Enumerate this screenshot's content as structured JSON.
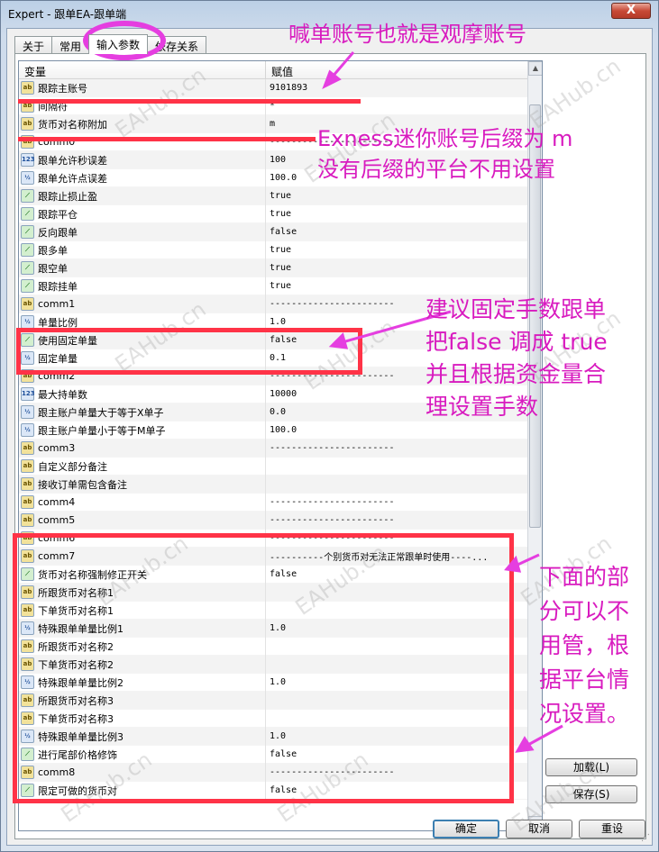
{
  "window": {
    "title": "Expert - 跟单EA-跟单端",
    "close_label": "X"
  },
  "tabs": [
    {
      "label": "关于",
      "active": false
    },
    {
      "label": "常用",
      "active": false
    },
    {
      "label": "输入参数",
      "active": true
    },
    {
      "label": "依存关系",
      "active": false
    }
  ],
  "grid": {
    "header_variable": "变量",
    "header_value": "赋值",
    "rows": [
      {
        "type": "ab",
        "name": "跟踪主账号",
        "value": "9101893"
      },
      {
        "type": "ab",
        "name": "间隔符",
        "value": "*"
      },
      {
        "type": "ab",
        "name": "货币对名称附加",
        "value": "m"
      },
      {
        "type": "ab",
        "name": "comm0",
        "value": "-----------------------"
      },
      {
        "type": "123",
        "name": "跟单允许秒误差",
        "value": "100"
      },
      {
        "type": "v2",
        "name": "跟单允许点误差",
        "value": "100.0"
      },
      {
        "type": "bool",
        "name": "跟踪止损止盈",
        "value": "true"
      },
      {
        "type": "bool",
        "name": "跟踪平仓",
        "value": "true"
      },
      {
        "type": "bool",
        "name": "反向跟单",
        "value": "false"
      },
      {
        "type": "bool",
        "name": "跟多单",
        "value": "true"
      },
      {
        "type": "bool",
        "name": "跟空单",
        "value": "true"
      },
      {
        "type": "bool",
        "name": "跟踪挂单",
        "value": "true"
      },
      {
        "type": "ab",
        "name": "comm1",
        "value": "-----------------------"
      },
      {
        "type": "v2",
        "name": "单量比例",
        "value": "1.0"
      },
      {
        "type": "bool",
        "name": "使用固定单量",
        "value": "false"
      },
      {
        "type": "v2",
        "name": "固定单量",
        "value": "0.1"
      },
      {
        "type": "ab",
        "name": "comm2",
        "value": "-----------------------"
      },
      {
        "type": "123",
        "name": "最大持单数",
        "value": "10000"
      },
      {
        "type": "v2",
        "name": "跟主账户单量大于等于X单子",
        "value": "0.0"
      },
      {
        "type": "v2",
        "name": "跟主账户单量小于等于M单子",
        "value": "100.0"
      },
      {
        "type": "ab",
        "name": "comm3",
        "value": "-----------------------"
      },
      {
        "type": "ab",
        "name": "自定义部分备注",
        "value": ""
      },
      {
        "type": "ab",
        "name": "接收订单需包含备注",
        "value": ""
      },
      {
        "type": "ab",
        "name": "comm4",
        "value": "-----------------------"
      },
      {
        "type": "ab",
        "name": "comm5",
        "value": "-----------------------"
      },
      {
        "type": "ab",
        "name": "comm6",
        "value": "-----------------------"
      },
      {
        "type": "ab",
        "name": "comm7",
        "value": "----------个别货币对无法正常跟单时使用----..."
      },
      {
        "type": "bool",
        "name": "货币对名称强制修正开关",
        "value": "false"
      },
      {
        "type": "ab",
        "name": "所跟货币对名称1",
        "value": ""
      },
      {
        "type": "ab",
        "name": "下单货币对名称1",
        "value": ""
      },
      {
        "type": "v2",
        "name": "特殊跟单单量比例1",
        "value": "1.0"
      },
      {
        "type": "ab",
        "name": "所跟货币对名称2",
        "value": ""
      },
      {
        "type": "ab",
        "name": "下单货币对名称2",
        "value": ""
      },
      {
        "type": "v2",
        "name": "特殊跟单单量比例2",
        "value": "1.0"
      },
      {
        "type": "ab",
        "name": "所跟货币对名称3",
        "value": ""
      },
      {
        "type": "ab",
        "name": "下单货币对名称3",
        "value": ""
      },
      {
        "type": "v2",
        "name": "特殊跟单单量比例3",
        "value": "1.0"
      },
      {
        "type": "bool",
        "name": "进行尾部价格修饰",
        "value": "false"
      },
      {
        "type": "ab",
        "name": "comm8",
        "value": "-----------------------"
      },
      {
        "type": "bool",
        "name": "限定可做的货币对",
        "value": "false"
      }
    ]
  },
  "buttons": {
    "load": "加载(L)",
    "save": "保存(S)",
    "ok": "确定",
    "cancel": "取消",
    "reset": "重设"
  },
  "annotations": {
    "note1": "喊单账号也就是观摩账号",
    "note2_line1": "Exness迷你账号后缀为 m",
    "note2_line2": "没有后缀的平台不用设置",
    "note3_line1": "建议固定手数跟单",
    "note3_line2": "把false 调成 true",
    "note3_line3": "并且根据资金量合",
    "note3_line4": "理设置手数",
    "note4_line1": "下面的部",
    "note4_line2": "分可以不",
    "note4_line3": "用管，根",
    "note4_line4": "据平台情",
    "note4_line5": "况设置。"
  },
  "watermark": "EAHub.cn",
  "colors": {
    "annotation": "#d81bbf",
    "highlight": "#ff3347",
    "ring": "#e53ee0"
  }
}
